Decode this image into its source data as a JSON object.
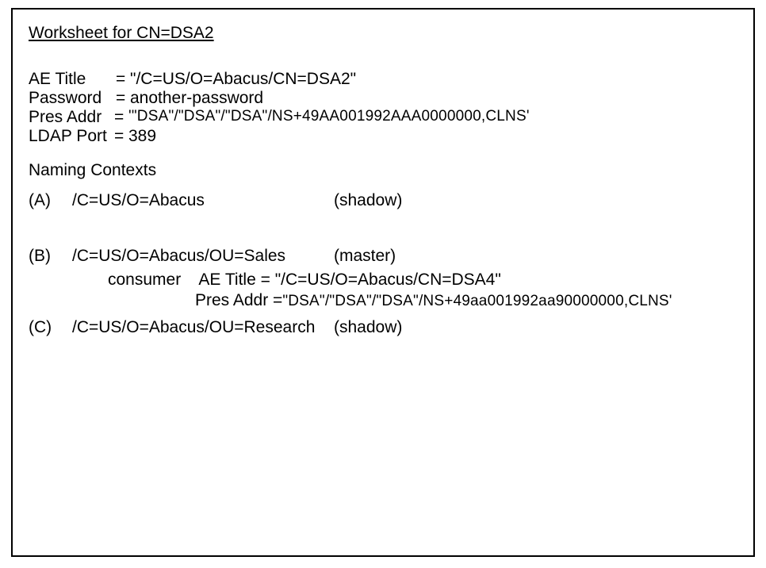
{
  "title": "Worksheet for CN=DSA2",
  "fields": {
    "ae_title_label": "AE Title",
    "ae_title_value": "\"/C=US/O=Abacus/CN=DSA2\"",
    "password_label": "Password",
    "password_value": "another-password",
    "pres_addr_label": "Pres Addr",
    "pres_addr_value": "'\"DSA\"/\"DSA\"/\"DSA\"/NS+49AA001992AAA0000000,CLNS'",
    "ldap_port_label": "LDAP Port",
    "ldap_port_value": "389"
  },
  "naming_contexts_header": "Naming Contexts",
  "contexts": {
    "a": {
      "letter": "(A)",
      "path": "/C=US/O=Abacus",
      "role": "(shadow)"
    },
    "b": {
      "letter": "(B)",
      "path": "/C=US/O=Abacus/OU=Sales",
      "role": "(master)",
      "consumer_label": "consumer",
      "consumer_ae_label": "AE Title =",
      "consumer_ae_value": "\"/C=US/O=Abacus/CN=DSA4\"",
      "consumer_pres_label": "Pres Addr =",
      "consumer_pres_value": "\"DSA\"/\"DSA\"/\"DSA\"/NS+49aa001992aa90000000,CLNS'"
    },
    "c": {
      "letter": "(C)",
      "path": "/C=US/O=Abacus/OU=Research",
      "role": "(shadow)"
    }
  }
}
